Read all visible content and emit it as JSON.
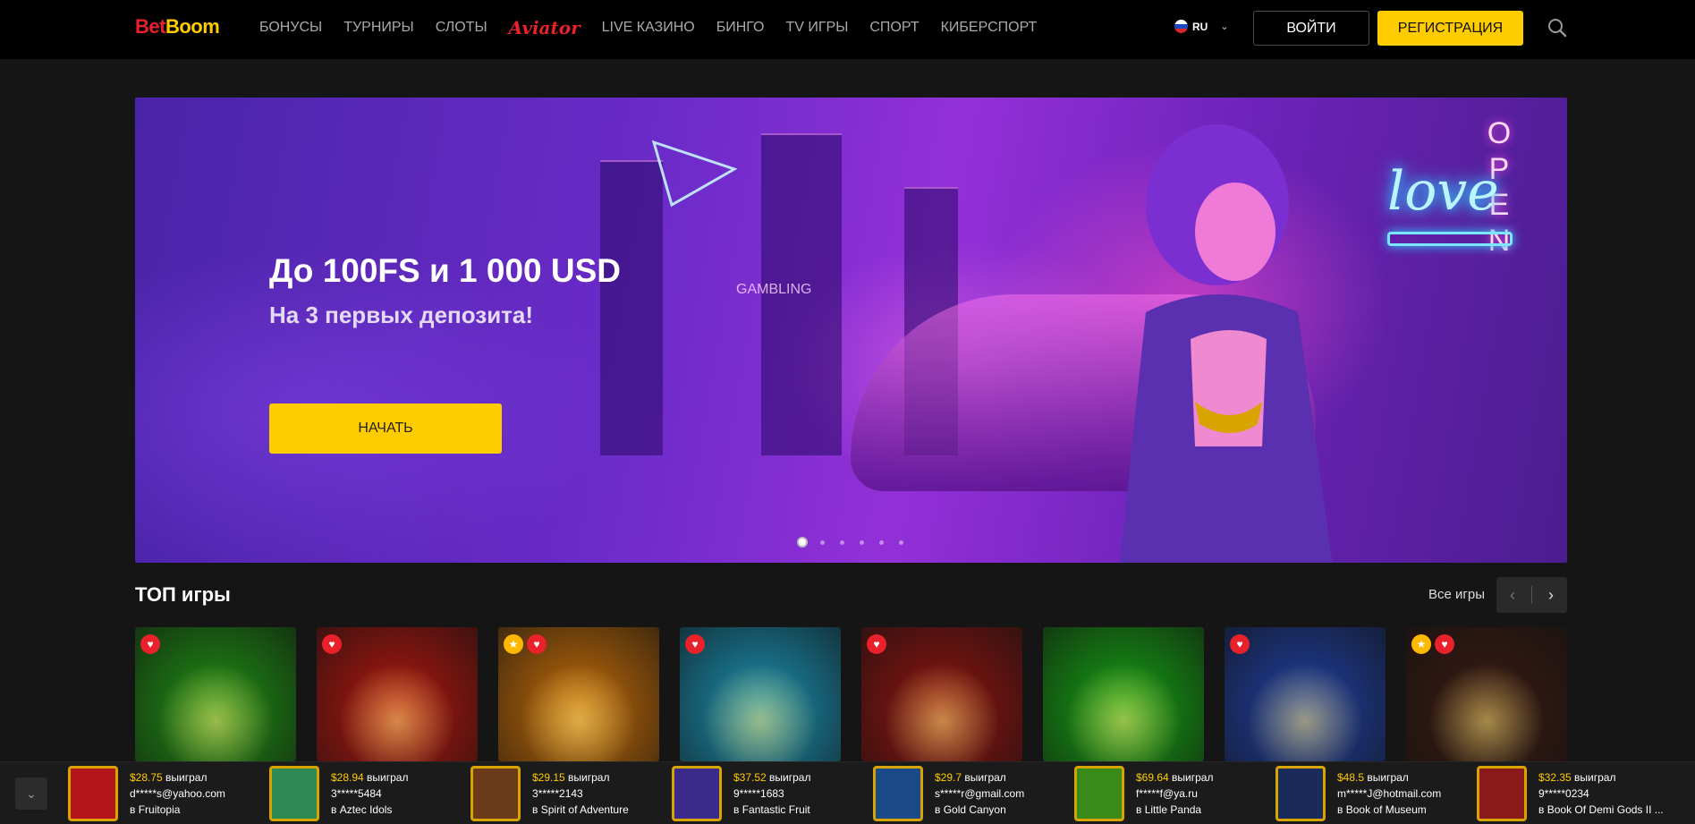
{
  "header": {
    "logo_part1": "Bet",
    "logo_part2": "Boom",
    "nav": [
      "БОНУСЫ",
      "ТУРНИРЫ",
      "СЛОТЫ",
      "Aviator",
      "LIVE КАЗИНО",
      "БИНГО",
      "TV ИГРЫ",
      "СПОРТ",
      "КИБЕРСПОРТ"
    ],
    "lang": "RU",
    "login_label": "ВОЙТИ",
    "register_label": "РЕГИСТРАЦИЯ"
  },
  "banner": {
    "title": "До 100FS и 1 000 USD",
    "subtitle": "На 3 первых депозита!",
    "cta_label": "НАЧАТЬ",
    "slides_count": 6,
    "active_slide": 1,
    "sign_love": "love",
    "sign_open": "OPEN",
    "sign_gambling": "GAMBLING"
  },
  "top_games": {
    "title": "ТОП игры",
    "all_label": "Все игры",
    "games": [
      {
        "badges": [
          "hot"
        ],
        "color": "#1f8f14"
      },
      {
        "badges": [
          "hot"
        ],
        "color": "#b0160f"
      },
      {
        "badges": [
          "star",
          "hot"
        ],
        "color": "#c06a08"
      },
      {
        "badges": [
          "hot"
        ],
        "color": "#1a8fb0"
      },
      {
        "badges": [
          "hot"
        ],
        "color": "#8e1410"
      },
      {
        "badges": [],
        "color": "#16a014"
      },
      {
        "badges": [
          "hot"
        ],
        "color": "#1f3fa0"
      },
      {
        "badges": [
          "star",
          "hot"
        ],
        "color": "#3a1a12"
      }
    ]
  },
  "winners": [
    {
      "amount": "$28.75",
      "won": "выиграл",
      "user": "d*****s@yahoo.com",
      "game": "Fruitopia",
      "color": "#b3141a"
    },
    {
      "amount": "$28.94",
      "won": "выиграл",
      "user": "3*****5484",
      "game": "Aztec Idols",
      "color": "#2c8a52"
    },
    {
      "amount": "$29.15",
      "won": "выиграл",
      "user": "3*****2143",
      "game": "Spirit of Adventure",
      "color": "#6a3a1a"
    },
    {
      "amount": "$37.52",
      "won": "выиграл",
      "user": "9*****1683",
      "game": "Fantastic Fruit",
      "color": "#3a2a8a"
    },
    {
      "amount": "$29.7",
      "won": "выиграл",
      "user": "s*****r@gmail.com",
      "game": "Gold Canyon",
      "color": "#1a4a8a"
    },
    {
      "amount": "$69.64",
      "won": "выиграл",
      "user": "f*****f@ya.ru",
      "game": "Little Panda",
      "color": "#3a8a1a"
    },
    {
      "amount": "$48.5",
      "won": "выиграл",
      "user": "m*****J@hotmail.com",
      "game": "Book of Museum",
      "color": "#1a2a5a"
    },
    {
      "amount": "$32.35",
      "won": "выиграл",
      "user": "9*****0234",
      "game": "Book Of Demi Gods II ...",
      "color": "#8a1a1a"
    }
  ],
  "winners_prefix": "в"
}
